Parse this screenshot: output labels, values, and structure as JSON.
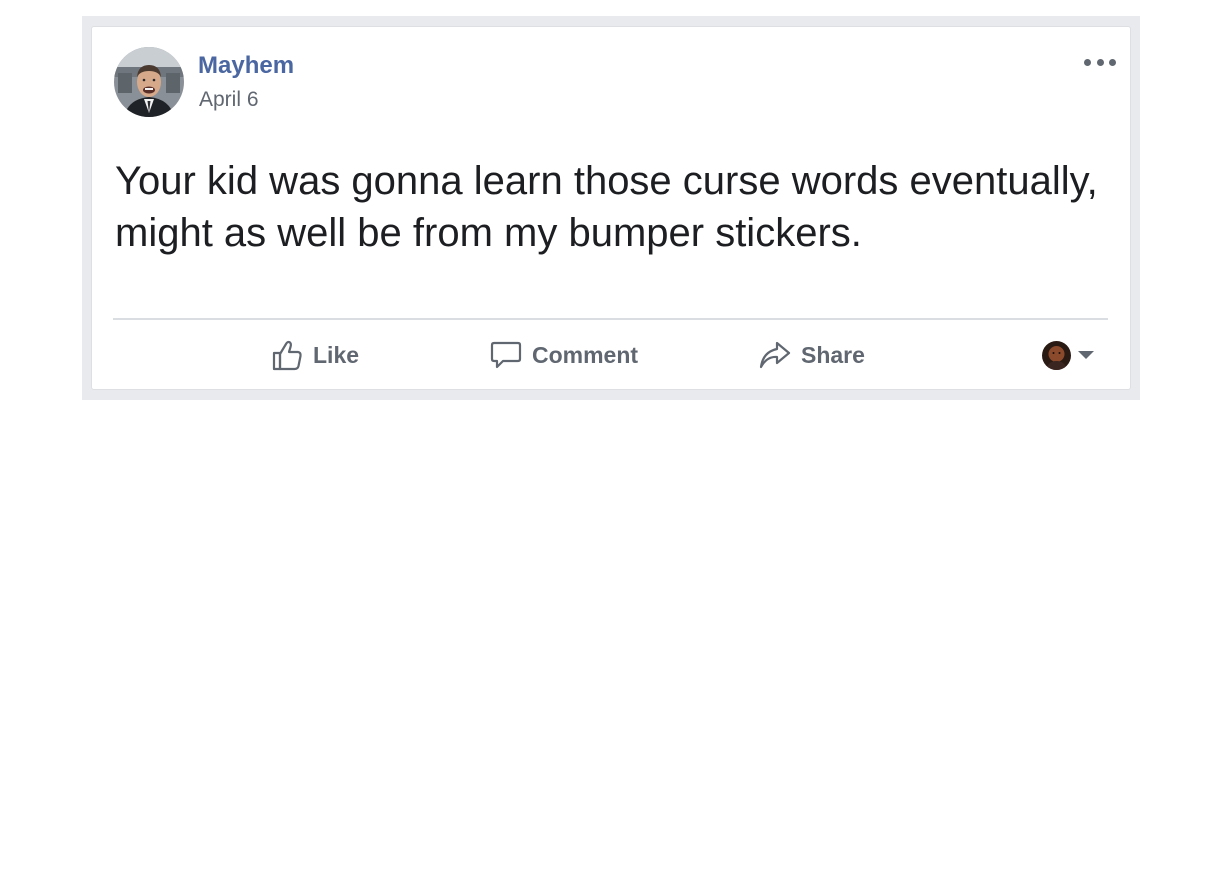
{
  "post": {
    "author": "Mayhem",
    "date": "April 6",
    "text": "Your kid was gonna learn those curse words eventually,\nmight as well be from my bumper stickers.",
    "menu_icon": "more-options-icon"
  },
  "actions": {
    "like_label": "Like",
    "comment_label": "Comment",
    "share_label": "Share",
    "like_icon": "thumbs-up-icon",
    "comment_icon": "speech-bubble-icon",
    "share_icon": "share-arrow-icon"
  },
  "colors": {
    "author_link": "#4b67a1",
    "secondary_text": "#606770",
    "primary_text": "#1c1e21",
    "card_border": "#dddfe2",
    "frame_background": "#e9eaed"
  }
}
